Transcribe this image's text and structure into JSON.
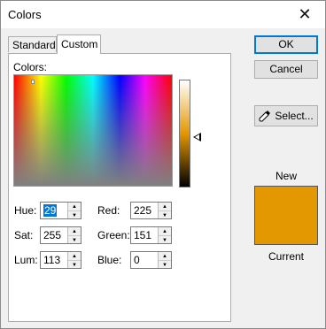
{
  "window": {
    "title": "Colors",
    "close_glyph": "✕"
  },
  "tabs": [
    {
      "label": "Standard",
      "active": false
    },
    {
      "label": "Custom",
      "active": true
    }
  ],
  "custom": {
    "colors_label": "Colors:",
    "hue": {
      "label": "Hue:",
      "value": "29"
    },
    "sat": {
      "label": "Sat:",
      "value": "255"
    },
    "lum": {
      "label": "Lum:",
      "value": "113"
    },
    "red": {
      "label": "Red:",
      "value": "225"
    },
    "green": {
      "label": "Green:",
      "value": "151"
    },
    "blue": {
      "label": "Blue:",
      "value": "0"
    }
  },
  "buttons": {
    "ok": "OK",
    "cancel": "Cancel",
    "select": "Select..."
  },
  "preview": {
    "new_label": "New",
    "current_label": "Current",
    "color": "#e39700"
  },
  "icons": {
    "close": "close-icon",
    "dropper": "eyedropper-icon",
    "spin_up": "▲",
    "spin_down": "▼"
  }
}
